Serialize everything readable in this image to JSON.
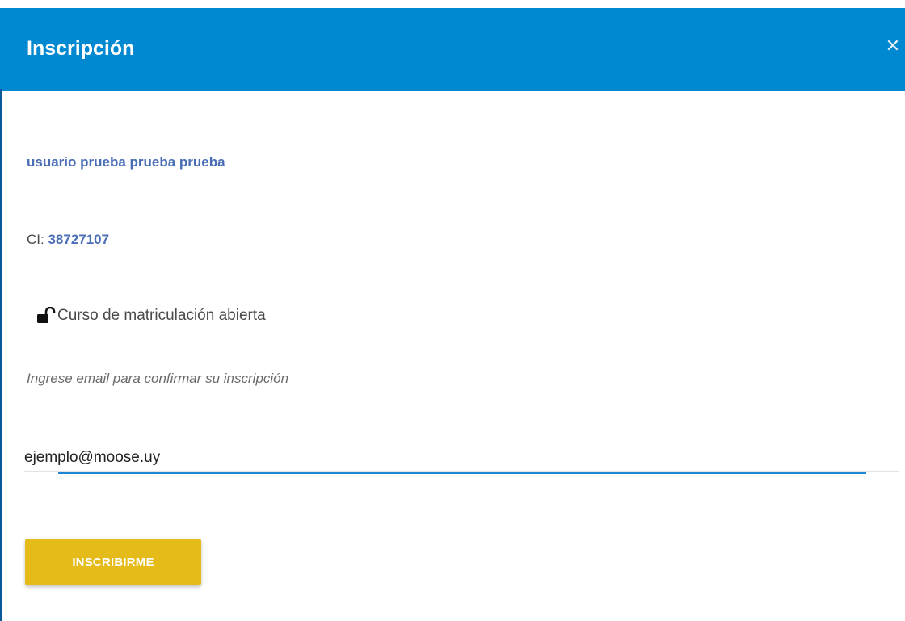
{
  "dialog": {
    "title": "Inscripción",
    "close_icon": "close-icon"
  },
  "user": {
    "name": "usuario prueba prueba prueba",
    "ci_label": "CI: ",
    "ci_value": "38727107"
  },
  "course": {
    "icon": "lock-open-icon",
    "type_label": "Curso de matriculación abierta"
  },
  "form": {
    "prompt": "Ingrese email para confirmar su inscripción",
    "email_value": "ejemplo@moose.uy"
  },
  "actions": {
    "submit_label": "INSCRIBIRME"
  },
  "colors": {
    "header_bg": "#0088d1",
    "accent_text": "#4a6eb6",
    "button_bg": "#e5bb1a",
    "focus_line": "#1e88d4"
  }
}
